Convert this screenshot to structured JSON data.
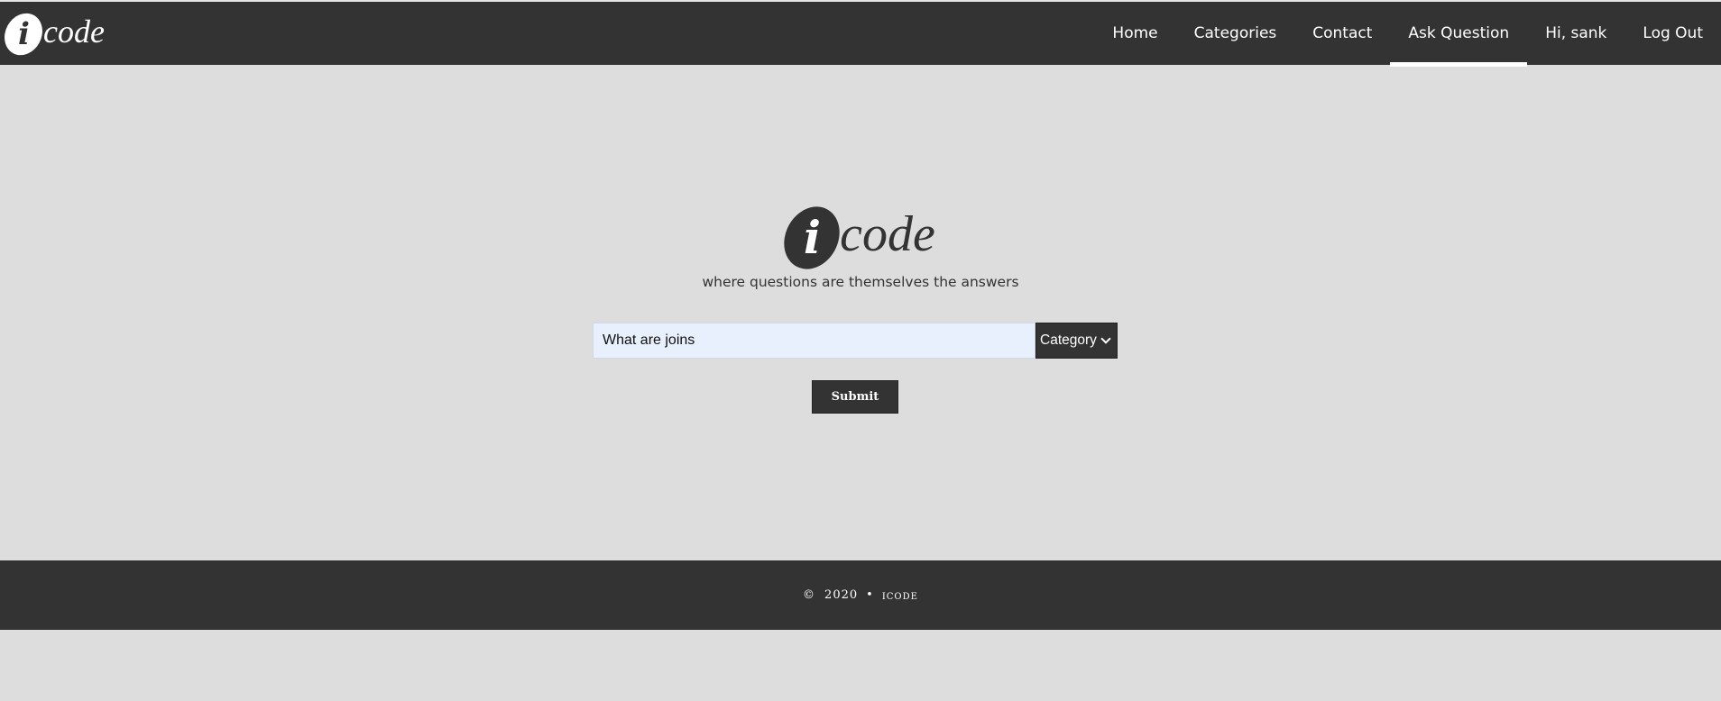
{
  "header": {
    "brand_mark": "i",
    "brand_text": "code",
    "nav": [
      {
        "label": "Home",
        "active": false
      },
      {
        "label": "Categories",
        "active": false
      },
      {
        "label": "Contact",
        "active": false
      },
      {
        "label": "Ask Question",
        "active": true
      },
      {
        "label": "Hi, sank",
        "active": false
      },
      {
        "label": "Log Out",
        "active": false
      }
    ]
  },
  "hero": {
    "logo_mark": "i",
    "logo_text": "code",
    "tagline": "where questions are themselves the answers"
  },
  "form": {
    "question_value": "What are joins",
    "category_selected": "Category",
    "submit_label": "Submit"
  },
  "footer": {
    "copyright_symbol": "©",
    "year": "2020",
    "separator": "•",
    "brand": "icode"
  },
  "colors": {
    "bar": "#333333",
    "background": "#dddddd",
    "input_fill": "#e8f0fe"
  }
}
